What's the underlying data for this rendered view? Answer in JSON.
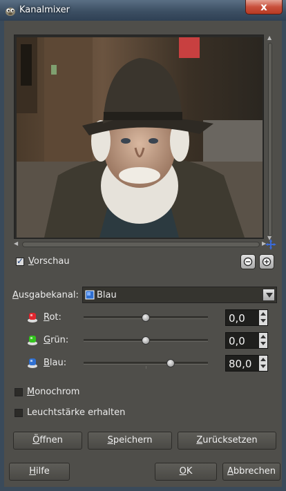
{
  "window": {
    "title": "Kanalmixer",
    "close_label": "x"
  },
  "preview": {
    "checkbox_label": "Vorschau",
    "checked": true
  },
  "output_channel": {
    "label": "Ausgabekanal:",
    "value": "Blau"
  },
  "channels": [
    {
      "label": "Rot:",
      "value": "0,0",
      "slider_fraction": 0.5,
      "color": "#e0262e"
    },
    {
      "label": "Grün:",
      "value": "0,0",
      "slider_fraction": 0.5,
      "color": "#34c41e"
    },
    {
      "label": "Blau:",
      "value": "80,0",
      "slider_fraction": 0.7,
      "color": "#2f6fd0"
    }
  ],
  "options": {
    "monochrom_label": "Monochrom",
    "monochrom_checked": false,
    "luminosity_label": "Leuchtstärke erhalten",
    "luminosity_checked": false
  },
  "actions": {
    "open": "Öffnen",
    "save": "Speichern",
    "reset": "Zurücksetzen"
  },
  "footer": {
    "help": "Hilfe",
    "ok": "OK",
    "cancel": "Abbrechen"
  },
  "colors": {
    "dialog_bg": "#4f4e4a",
    "titlebar": "#3c4f63",
    "close_button": "#c9503c"
  }
}
